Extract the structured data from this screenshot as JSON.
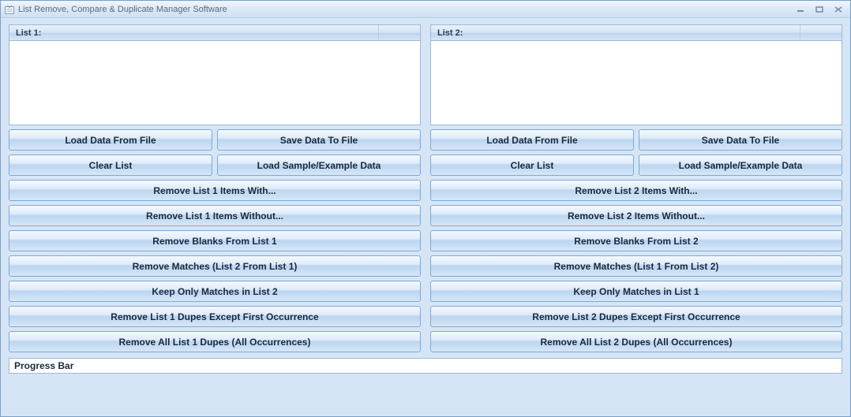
{
  "window": {
    "title": "List Remove, Compare & Duplicate Manager Software"
  },
  "list1": {
    "header": "List 1:",
    "buttons": {
      "load_file": "Load Data From File",
      "save_file": "Save Data To File",
      "clear": "Clear List",
      "load_sample": "Load Sample/Example Data",
      "remove_with": "Remove List 1 Items With...",
      "remove_without": "Remove List 1 Items Without...",
      "remove_blanks": "Remove Blanks From List 1",
      "remove_matches": "Remove Matches (List 2 From List 1)",
      "keep_matches": "Keep Only Matches in List 2",
      "dupes_except_first": "Remove List 1 Dupes Except First Occurrence",
      "dupes_all": "Remove All List 1 Dupes (All Occurrences)"
    }
  },
  "list2": {
    "header": "List 2:",
    "buttons": {
      "load_file": "Load Data From File",
      "save_file": "Save Data To File",
      "clear": "Clear List",
      "load_sample": "Load Sample/Example Data",
      "remove_with": "Remove List 2 Items With...",
      "remove_without": "Remove List 2 Items Without...",
      "remove_blanks": "Remove Blanks From List 2",
      "remove_matches": "Remove Matches (List 1 From List 2)",
      "keep_matches": "Keep Only Matches in List 1",
      "dupes_except_first": "Remove List 2 Dupes Except First Occurrence",
      "dupes_all": "Remove All List 2 Dupes (All Occurrences)"
    }
  },
  "progress": {
    "label": "Progress Bar"
  }
}
